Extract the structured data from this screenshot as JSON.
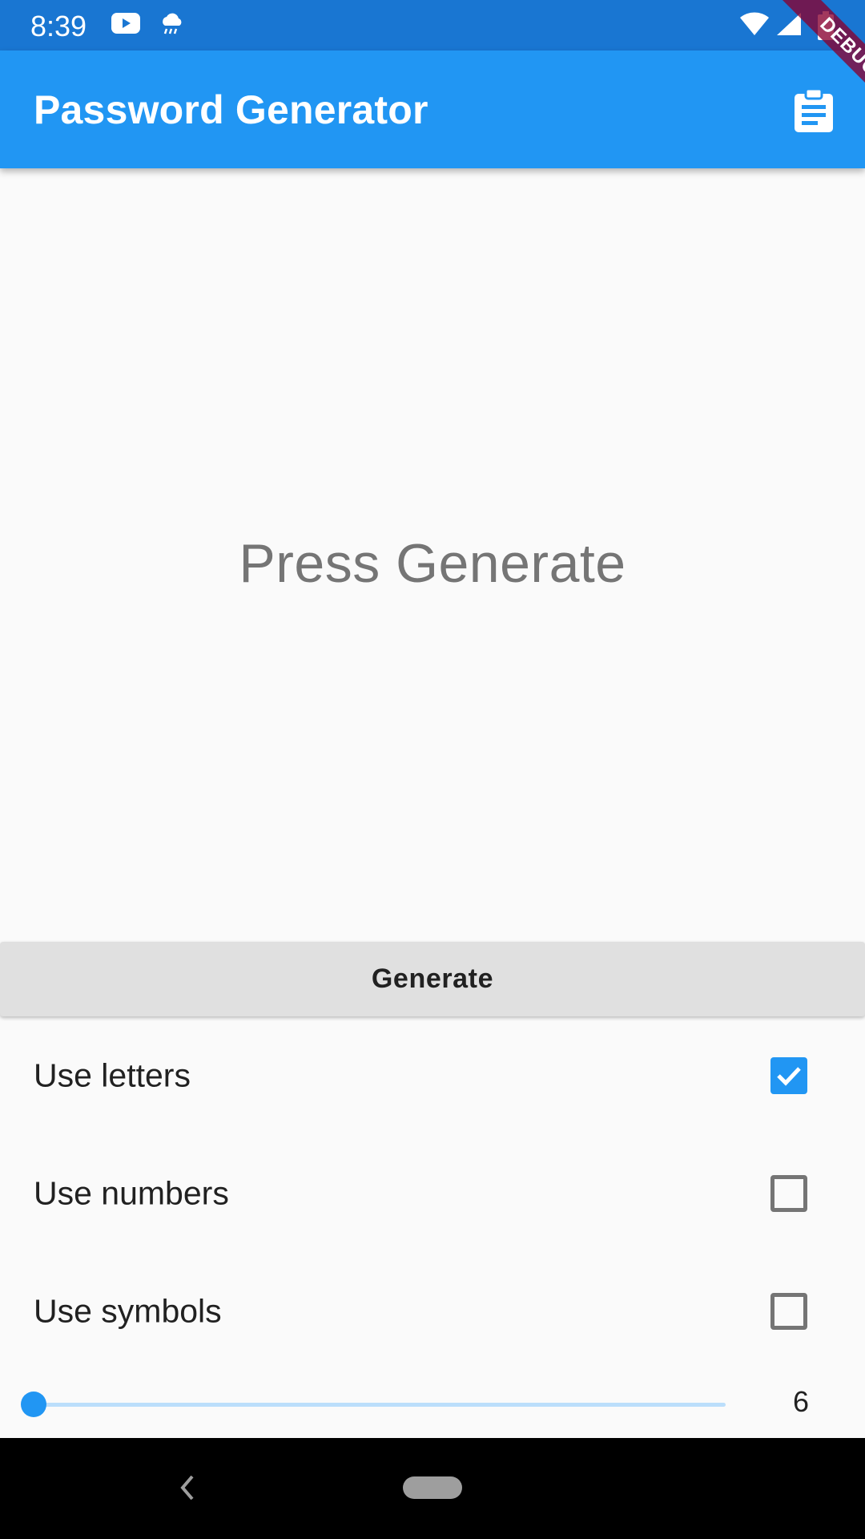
{
  "status_bar": {
    "time": "8:39",
    "icons": [
      "youtube-icon",
      "weather-icon",
      "wifi-icon",
      "signal-icon",
      "battery-icon"
    ]
  },
  "debug_banner": "DEBUG",
  "app_bar": {
    "title": "Password Generator",
    "action_icon": "clipboard-icon",
    "color": "#2196f3"
  },
  "display": {
    "text": "Press Generate"
  },
  "generate_button": {
    "label": "Generate"
  },
  "options": [
    {
      "label": "Use letters",
      "checked": true
    },
    {
      "label": "Use numbers",
      "checked": false
    },
    {
      "label": "Use symbols",
      "checked": false
    }
  ],
  "length_slider": {
    "value": "6",
    "fill_fraction": 0.0
  },
  "colors": {
    "accent": "#2196f3",
    "status_bar": "#1976d2"
  }
}
